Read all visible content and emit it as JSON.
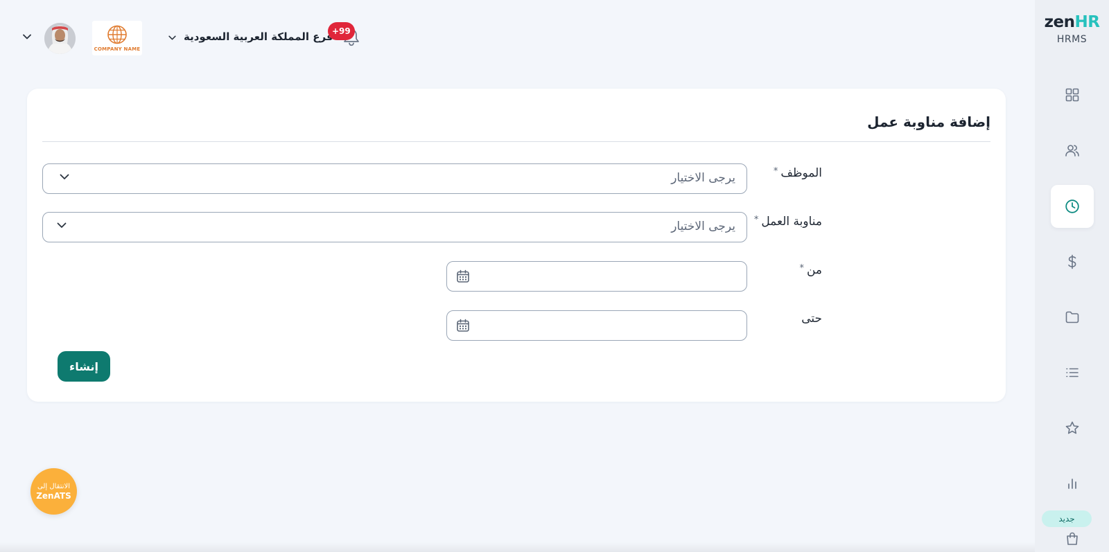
{
  "brand": {
    "name_part1": "zen",
    "name_part2": "HR",
    "product": "HRMS"
  },
  "sidebar": {
    "items": [
      {
        "icon": "grid-icon",
        "name": "sidebar-item-dashboard"
      },
      {
        "icon": "users-icon",
        "name": "sidebar-item-employees"
      },
      {
        "icon": "clock-icon",
        "name": "sidebar-item-attendance",
        "active": true
      },
      {
        "icon": "dollar-icon",
        "name": "sidebar-item-payroll"
      },
      {
        "icon": "folder-icon",
        "name": "sidebar-item-documents"
      },
      {
        "icon": "list-icon",
        "name": "sidebar-item-requests"
      },
      {
        "icon": "star-icon",
        "name": "sidebar-item-performance"
      },
      {
        "icon": "bar-chart-icon",
        "name": "sidebar-item-reports"
      },
      {
        "icon": "bag-icon",
        "name": "sidebar-item-recruitment"
      }
    ],
    "new_badge": "جديد"
  },
  "header": {
    "company_logo_text": "COMPANY NAME",
    "branch": "فرع المملكة العربية السعودية",
    "notifications_count": "+99"
  },
  "form": {
    "title": "إضافة مناوبة عمل",
    "required_mark": "*",
    "employee_label": "الموظف",
    "employee_placeholder": "يرجى الاختيار",
    "shift_label": "مناوبة العمل",
    "shift_placeholder": "يرجى الاختيار",
    "from_label": "من",
    "to_label": "حتى",
    "submit_label": "إنشاء"
  },
  "ats": {
    "line1": "الانتقال إلى",
    "line2": "ZenATS"
  },
  "colors": {
    "accent": "#0e7a6f",
    "brand_teal": "#27c1bd",
    "notification": "#e0263a",
    "ats": "#fbb03b"
  }
}
